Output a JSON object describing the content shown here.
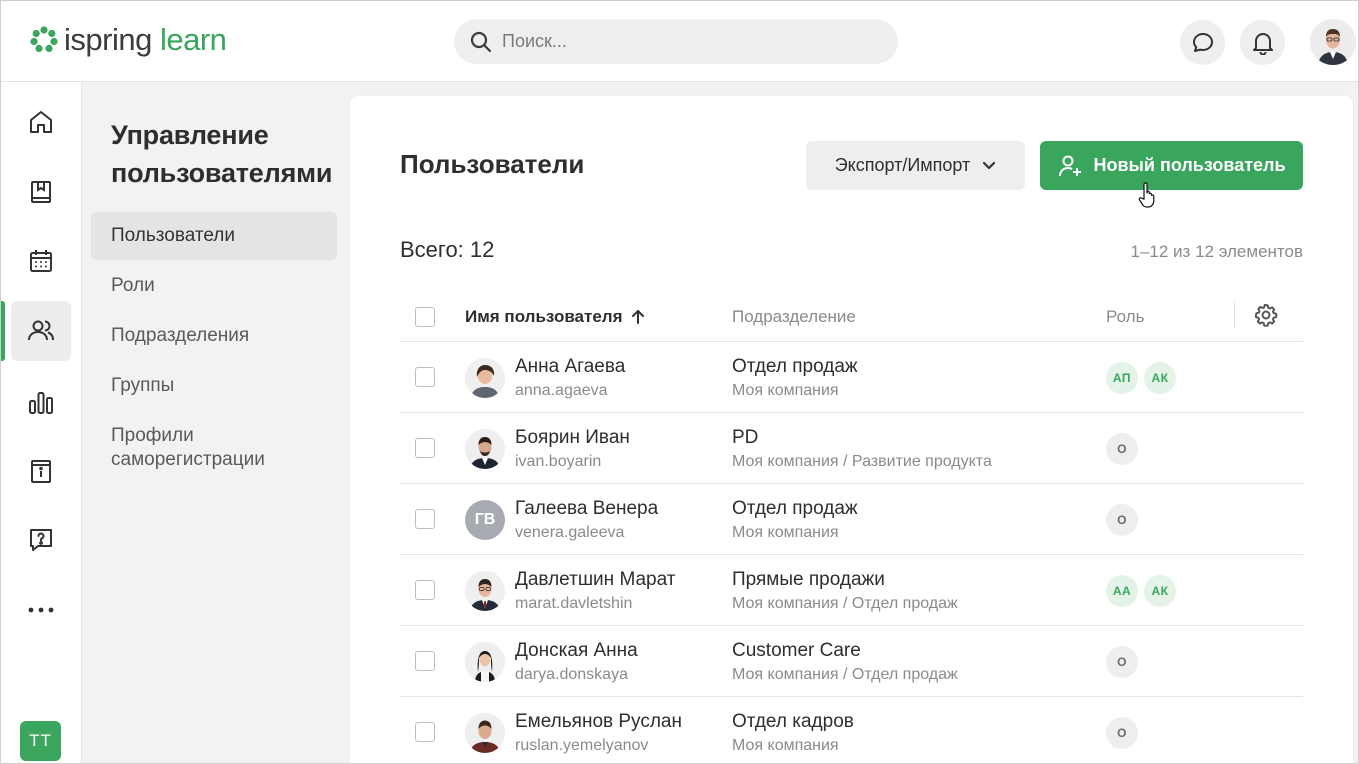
{
  "colors": {
    "accent": "#3aa55d",
    "surface": "#ffffff",
    "background": "#f2f2f2"
  },
  "header": {
    "logo_part1": "ispring",
    "logo_part2": "learn",
    "search_placeholder": "Поиск..."
  },
  "rail": {
    "icons": [
      "home-icon",
      "book-icon",
      "calendar-icon",
      "users-icon",
      "bar-chart-icon",
      "info-board-icon",
      "question-bubble-icon",
      "more-icon"
    ],
    "active": "users-icon",
    "user_initials": "TT"
  },
  "sidebar": {
    "title": "Управление пользователями",
    "items": [
      {
        "label": "Пользователи",
        "active": true
      },
      {
        "label": "Роли"
      },
      {
        "label": "Подразделения"
      },
      {
        "label": "Группы"
      },
      {
        "label": "Профили саморегистрации"
      }
    ]
  },
  "main": {
    "title": "Пользователи",
    "export_label": "Экспорт/Импорт",
    "new_user_label": "Новый пользователь",
    "total_label": "Всего: 12",
    "range_label": "1–12 из 12 элементов"
  },
  "table": {
    "columns": {
      "name": "Имя пользователя",
      "department": "Подразделение",
      "role": "Роль"
    },
    "rows": [
      {
        "name": "Анна Агаева",
        "login": "anna.agaeva",
        "dept": "Отдел продаж",
        "path": "Моя компания",
        "roles": [
          "АП",
          "АК"
        ],
        "initials": ""
      },
      {
        "name": "Боярин Иван",
        "login": "ivan.boyarin",
        "dept": "PD",
        "path": "Моя компания / Развитие продукта",
        "roles": [
          "О"
        ],
        "initials": ""
      },
      {
        "name": "Галеева Венера",
        "login": "venera.galeeva",
        "dept": "Отдел продаж",
        "path": "Моя компания",
        "roles": [
          "О"
        ],
        "initials": "ГВ"
      },
      {
        "name": "Давлетшин Марат",
        "login": "marat.davletshin",
        "dept": "Прямые продажи",
        "path": "Моя компания / Отдел продаж",
        "roles": [
          "АА",
          "АК"
        ],
        "initials": ""
      },
      {
        "name": "Донская Анна",
        "login": "darya.donskaya",
        "dept": "Customer Care",
        "path": "Моя компания / Отдел продаж",
        "roles": [
          "О"
        ],
        "initials": ""
      },
      {
        "name": "Емельянов Руслан",
        "login": "ruslan.yemelyanov",
        "dept": "Отдел кадров",
        "path": "Моя компания",
        "roles": [
          "О"
        ],
        "initials": ""
      }
    ]
  }
}
